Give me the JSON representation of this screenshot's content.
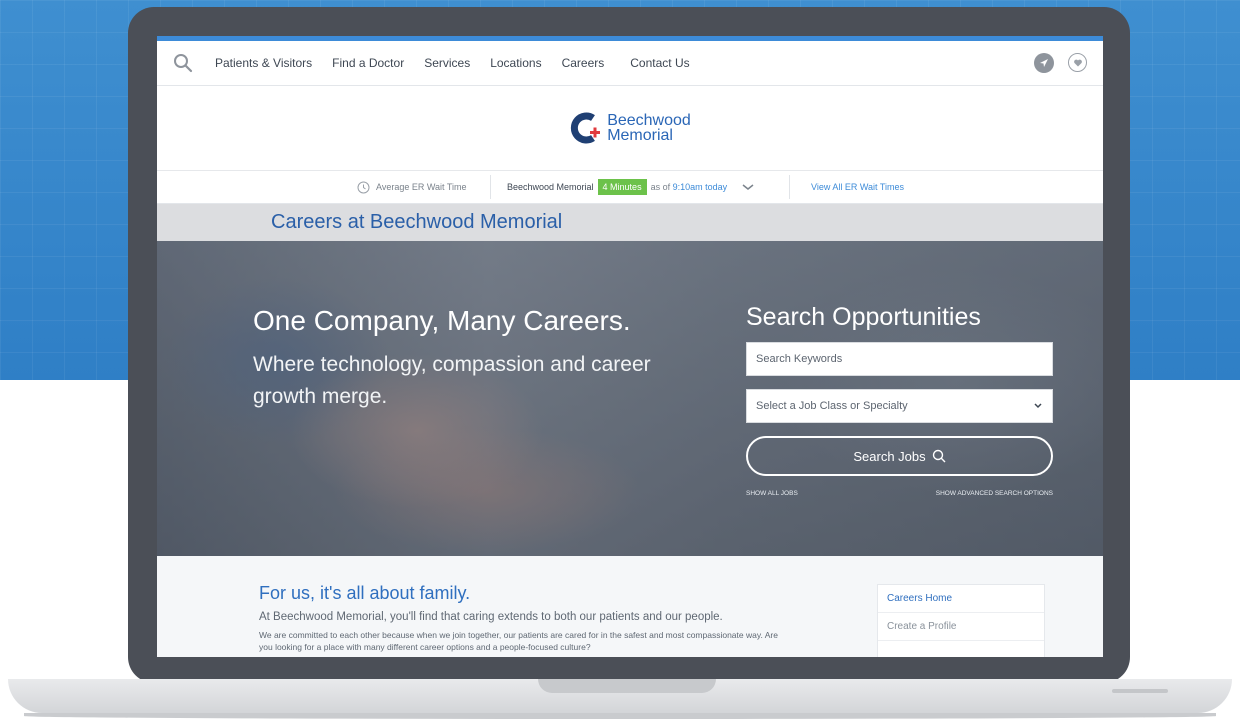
{
  "nav": {
    "items": [
      "Patients & Visitors",
      "Find a Doctor",
      "Services",
      "Locations",
      "Careers",
      "Contact Us"
    ]
  },
  "logo": {
    "line1": "Beechwood",
    "line2": "Memorial",
    "brand_color": "#2a66b6",
    "accent_color": "#e03a3e"
  },
  "er_bar": {
    "label": "Average ER Wait Time",
    "location": "Beechwood Memorial",
    "wait": "4 Minutes",
    "as_of_prefix": "as of",
    "as_of_time": "9:10am today",
    "view_all": "View All ER Wait Times",
    "badge_color": "#6cc24a"
  },
  "careers_band": {
    "title": "Careers at Beechwood Memorial"
  },
  "hero": {
    "title": "One Company, Many Careers.",
    "subtitle": "Where technology, compassion and career growth merge."
  },
  "search": {
    "title": "Search Opportunities",
    "keywords_placeholder": "Search Keywords",
    "job_class_placeholder": "Select a Job Class or Specialty",
    "button_label": "Search Jobs",
    "show_all": "SHOW ALL JOBS",
    "show_advanced": "SHOW ADVANCED SEARCH OPTIONS"
  },
  "family": {
    "title": "For us, it's all about family.",
    "intro": "At Beechwood Memorial, you'll find that caring extends to both our patients and our people.",
    "body": "We are committed to each other because when we join together, our patients are cared for in the safest and most compassionate way. Are you looking for a place with many different career options and a people-focused culture?"
  },
  "sidebar": {
    "items": [
      "Careers Home",
      "Create a Profile"
    ]
  }
}
